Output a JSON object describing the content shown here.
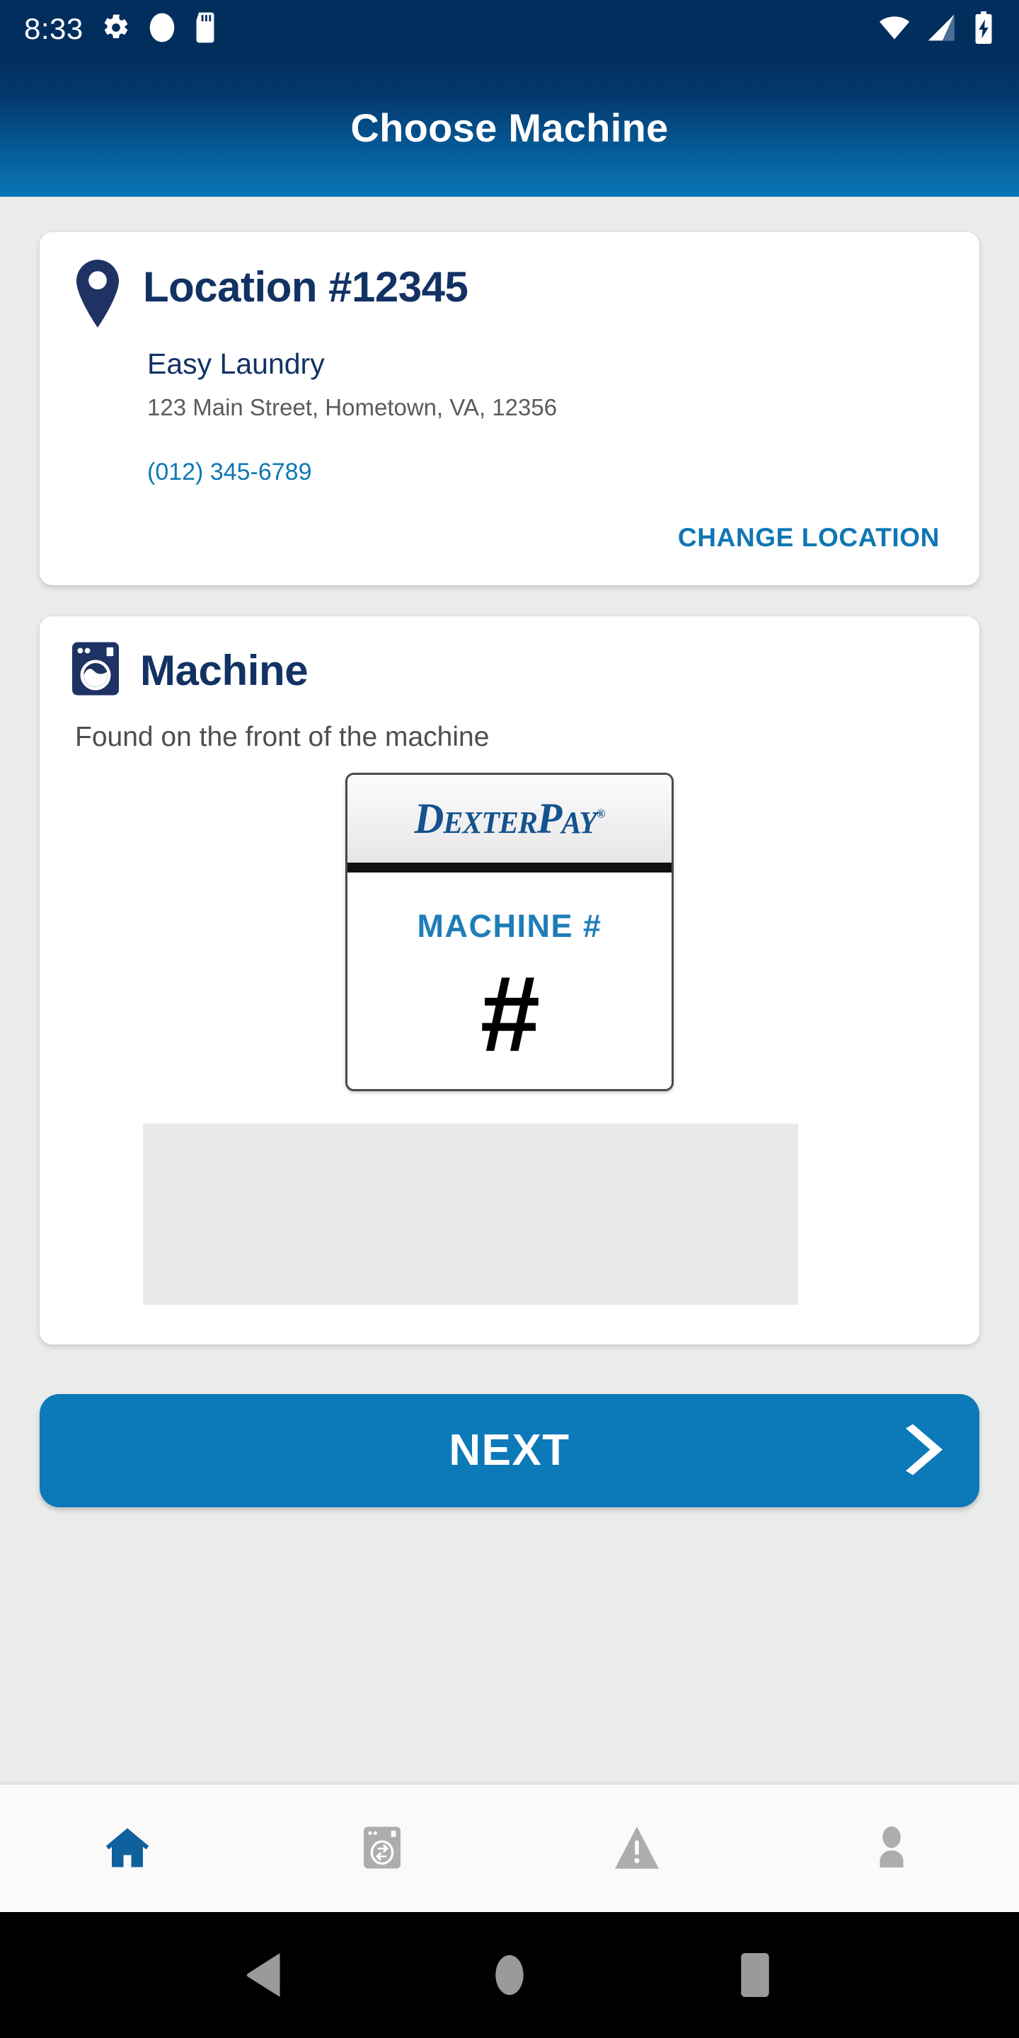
{
  "status_bar": {
    "time": "8:33",
    "left_icons": [
      "gear-icon",
      "circle-icon",
      "sd-card-icon"
    ],
    "right_icons": [
      "wifi-icon",
      "cellular-signal-icon",
      "battery-charging-icon"
    ],
    "background_color": "#022E5E"
  },
  "app_bar": {
    "title": "Choose Machine",
    "gradient_from": "#022E5E",
    "gradient_to": "#0A74B4"
  },
  "location_card": {
    "pin_icon": "location-pin-icon",
    "title": "Location #12345",
    "name": "Easy Laundry",
    "address": "123 Main Street, Hometown, VA, 12356",
    "phone": "(012) 345-6789",
    "change_location_label": "CHANGE LOCATION",
    "title_color": "#123263",
    "link_color": "#1078B4"
  },
  "machine_card": {
    "icon": "washing-machine-icon",
    "title": "Machine",
    "hint": "Found on the front of the machine",
    "label_image": {
      "brand": "DexterPay",
      "brand_caps_large": "D",
      "brand_rest": "EXTER",
      "brand_caps_large2": "P",
      "brand_rest2": "AY",
      "registered_mark": "®",
      "machine_label": "MACHINE #",
      "hash_symbol": "#",
      "brand_color": "#15528F",
      "machine_label_color": "#1E7DB8"
    },
    "machine_number_input": {
      "value": "",
      "placeholder": ""
    }
  },
  "next_button": {
    "label": "NEXT",
    "icon": "chevron-right-icon",
    "color": "#0C79B8"
  },
  "bottom_nav": {
    "items": [
      {
        "name": "home",
        "icon": "home-icon",
        "active": true
      },
      {
        "name": "machines",
        "icon": "washer-cycle-icon",
        "active": false
      },
      {
        "name": "alerts",
        "icon": "warning-triangle-icon",
        "active": false
      },
      {
        "name": "account",
        "icon": "person-icon",
        "active": false
      }
    ],
    "active_color": "#10609E",
    "inactive_color": "#ADADAD"
  },
  "system_nav": {
    "buttons": [
      {
        "name": "back",
        "icon": "back-triangle-icon"
      },
      {
        "name": "home",
        "icon": "home-circle-icon"
      },
      {
        "name": "recents",
        "icon": "recents-square-icon"
      }
    ],
    "color": "#9A9A9A",
    "background": "#000000"
  }
}
